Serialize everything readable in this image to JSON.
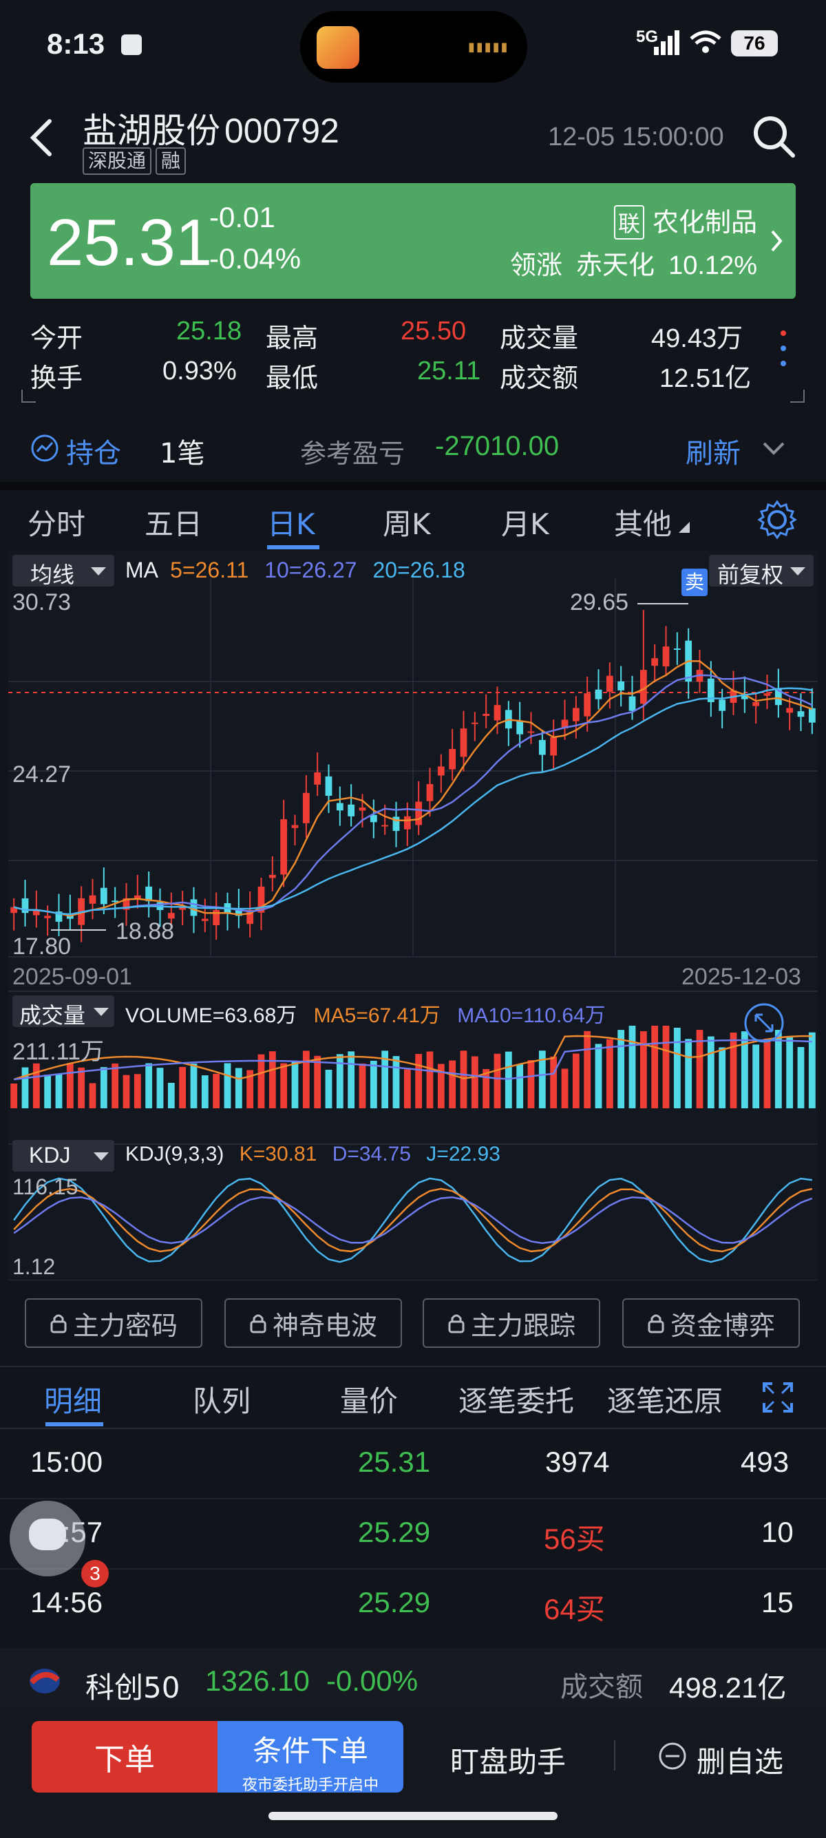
{
  "status": {
    "time": "8:13",
    "network": "5G",
    "battery": "76"
  },
  "header": {
    "stock_name": "盐湖股份",
    "stock_code": "000792",
    "tags": [
      "深股通",
      "融"
    ],
    "datetime": "12-05 15:00:00"
  },
  "quote": {
    "price": "25.31",
    "change": "-0.01",
    "change_pct": "-0.04%",
    "sector_tag": "联",
    "sector": "农化制品",
    "leader_label": "领涨",
    "leader_name": "赤天化",
    "leader_pct": "10.12%"
  },
  "stats": {
    "open_label": "今开",
    "open": "25.18",
    "high_label": "最高",
    "high": "25.50",
    "vol_label": "成交量",
    "vol": "49.43万",
    "turn_label": "换手",
    "turn": "0.93%",
    "low_label": "最低",
    "low": "25.11",
    "amt_label": "成交额",
    "amt": "12.51亿"
  },
  "position": {
    "label": "持仓",
    "count": "1笔",
    "pnl_label": "参考盈亏",
    "pnl": "-27010.00",
    "refresh": "刷新"
  },
  "ktabs": [
    "分时",
    "五日",
    "日K",
    "周K",
    "月K",
    "其他"
  ],
  "ma_bar": {
    "selector": "均线",
    "ma": "MA",
    "ma5": "5=26.11",
    "ma10": "10=26.27",
    "ma20": "20=26.18",
    "adjust": "前复权",
    "sell_tag": "卖"
  },
  "price_axis": {
    "top": "30.73",
    "mid": "24.27",
    "bottom": "17.80",
    "peak": "29.65",
    "trough": "18.88"
  },
  "date_axis": {
    "start": "2025-09-01",
    "end": "2025-12-03"
  },
  "volume_bar": {
    "selector": "成交量",
    "volume": "VOLUME=63.68万",
    "ma5": "MA5=67.41万",
    "ma10": "MA10=110.64万",
    "max": "211.11万"
  },
  "kdj_bar": {
    "selector": "KDJ",
    "params": "KDJ(9,3,3)",
    "k": "K=30.81",
    "d": "D=34.75",
    "j": "J=22.93",
    "max": "116.15",
    "min": "1.12"
  },
  "locked_tools": [
    "主力密码",
    "神奇电波",
    "主力跟踪",
    "资金博弈"
  ],
  "detail_tabs": [
    "明细",
    "队列",
    "量价",
    "逐笔委托",
    "逐笔还原"
  ],
  "ticks": [
    {
      "time": "15:00",
      "price": "25.31",
      "vol": "3974",
      "count": "493"
    },
    {
      "time": "14:57",
      "price": "25.29",
      "vol": "56买",
      "count": "10"
    },
    {
      "time": "14:56",
      "price": "25.29",
      "vol": "64买",
      "count": "15"
    }
  ],
  "float_badge": "3",
  "index_bar": {
    "name": "科创50",
    "value": "1326.10",
    "pct": "-0.00%",
    "amt_label": "成交额",
    "amt": "498.21亿"
  },
  "actions": {
    "order": "下单",
    "cond_order": "条件下单",
    "cond_sub": "夜市委托助手开启中",
    "assistant": "盯盘助手",
    "remove": "删自选"
  },
  "colors": {
    "up": "#ef3e36",
    "down": "#3fbf52",
    "accent": "#4c8ff5",
    "cyan_candle": "#52d9e8",
    "ma5": "#f08a2c",
    "ma10": "#6f7cf0",
    "ma20": "#4ab7f0"
  },
  "chart_data": {
    "type": "candlestick",
    "ohlc_approx": {
      "x": [
        "2025-09-01",
        "2025-09-08",
        "2025-09-15",
        "2025-09-22",
        "2025-09-29",
        "2025-10-13",
        "2025-10-20",
        "2025-10-27",
        "2025-11-03",
        "2025-11-10",
        "2025-11-17",
        "2025-11-24",
        "2025-12-01",
        "2025-12-03"
      ],
      "close": [
        19.4,
        19.8,
        19.6,
        19.3,
        20.2,
        23.1,
        22.6,
        23.8,
        25.0,
        25.6,
        27.0,
        28.4,
        26.4,
        25.8
      ]
    },
    "ma": {
      "ma5": 26.11,
      "ma10": 26.27,
      "ma20": 26.18
    },
    "ylim": [
      17.8,
      30.73
    ],
    "annotations": {
      "high": 29.65,
      "low": 18.88
    }
  }
}
